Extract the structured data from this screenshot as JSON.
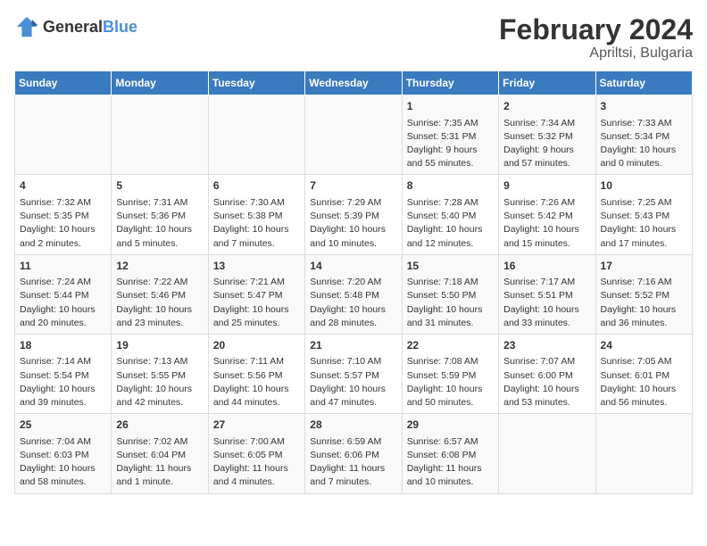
{
  "header": {
    "logo_general": "General",
    "logo_blue": "Blue",
    "title": "February 2024",
    "subtitle": "Apriltsi, Bulgaria"
  },
  "weekdays": [
    "Sunday",
    "Monday",
    "Tuesday",
    "Wednesday",
    "Thursday",
    "Friday",
    "Saturday"
  ],
  "weeks": [
    [
      {
        "day": "",
        "info": ""
      },
      {
        "day": "",
        "info": ""
      },
      {
        "day": "",
        "info": ""
      },
      {
        "day": "",
        "info": ""
      },
      {
        "day": "1",
        "info": "Sunrise: 7:35 AM\nSunset: 5:31 PM\nDaylight: 9 hours and 55 minutes."
      },
      {
        "day": "2",
        "info": "Sunrise: 7:34 AM\nSunset: 5:32 PM\nDaylight: 9 hours and 57 minutes."
      },
      {
        "day": "3",
        "info": "Sunrise: 7:33 AM\nSunset: 5:34 PM\nDaylight: 10 hours and 0 minutes."
      }
    ],
    [
      {
        "day": "4",
        "info": "Sunrise: 7:32 AM\nSunset: 5:35 PM\nDaylight: 10 hours and 2 minutes."
      },
      {
        "day": "5",
        "info": "Sunrise: 7:31 AM\nSunset: 5:36 PM\nDaylight: 10 hours and 5 minutes."
      },
      {
        "day": "6",
        "info": "Sunrise: 7:30 AM\nSunset: 5:38 PM\nDaylight: 10 hours and 7 minutes."
      },
      {
        "day": "7",
        "info": "Sunrise: 7:29 AM\nSunset: 5:39 PM\nDaylight: 10 hours and 10 minutes."
      },
      {
        "day": "8",
        "info": "Sunrise: 7:28 AM\nSunset: 5:40 PM\nDaylight: 10 hours and 12 minutes."
      },
      {
        "day": "9",
        "info": "Sunrise: 7:26 AM\nSunset: 5:42 PM\nDaylight: 10 hours and 15 minutes."
      },
      {
        "day": "10",
        "info": "Sunrise: 7:25 AM\nSunset: 5:43 PM\nDaylight: 10 hours and 17 minutes."
      }
    ],
    [
      {
        "day": "11",
        "info": "Sunrise: 7:24 AM\nSunset: 5:44 PM\nDaylight: 10 hours and 20 minutes."
      },
      {
        "day": "12",
        "info": "Sunrise: 7:22 AM\nSunset: 5:46 PM\nDaylight: 10 hours and 23 minutes."
      },
      {
        "day": "13",
        "info": "Sunrise: 7:21 AM\nSunset: 5:47 PM\nDaylight: 10 hours and 25 minutes."
      },
      {
        "day": "14",
        "info": "Sunrise: 7:20 AM\nSunset: 5:48 PM\nDaylight: 10 hours and 28 minutes."
      },
      {
        "day": "15",
        "info": "Sunrise: 7:18 AM\nSunset: 5:50 PM\nDaylight: 10 hours and 31 minutes."
      },
      {
        "day": "16",
        "info": "Sunrise: 7:17 AM\nSunset: 5:51 PM\nDaylight: 10 hours and 33 minutes."
      },
      {
        "day": "17",
        "info": "Sunrise: 7:16 AM\nSunset: 5:52 PM\nDaylight: 10 hours and 36 minutes."
      }
    ],
    [
      {
        "day": "18",
        "info": "Sunrise: 7:14 AM\nSunset: 5:54 PM\nDaylight: 10 hours and 39 minutes."
      },
      {
        "day": "19",
        "info": "Sunrise: 7:13 AM\nSunset: 5:55 PM\nDaylight: 10 hours and 42 minutes."
      },
      {
        "day": "20",
        "info": "Sunrise: 7:11 AM\nSunset: 5:56 PM\nDaylight: 10 hours and 44 minutes."
      },
      {
        "day": "21",
        "info": "Sunrise: 7:10 AM\nSunset: 5:57 PM\nDaylight: 10 hours and 47 minutes."
      },
      {
        "day": "22",
        "info": "Sunrise: 7:08 AM\nSunset: 5:59 PM\nDaylight: 10 hours and 50 minutes."
      },
      {
        "day": "23",
        "info": "Sunrise: 7:07 AM\nSunset: 6:00 PM\nDaylight: 10 hours and 53 minutes."
      },
      {
        "day": "24",
        "info": "Sunrise: 7:05 AM\nSunset: 6:01 PM\nDaylight: 10 hours and 56 minutes."
      }
    ],
    [
      {
        "day": "25",
        "info": "Sunrise: 7:04 AM\nSunset: 6:03 PM\nDaylight: 10 hours and 58 minutes."
      },
      {
        "day": "26",
        "info": "Sunrise: 7:02 AM\nSunset: 6:04 PM\nDaylight: 11 hours and 1 minute."
      },
      {
        "day": "27",
        "info": "Sunrise: 7:00 AM\nSunset: 6:05 PM\nDaylight: 11 hours and 4 minutes."
      },
      {
        "day": "28",
        "info": "Sunrise: 6:59 AM\nSunset: 6:06 PM\nDaylight: 11 hours and 7 minutes."
      },
      {
        "day": "29",
        "info": "Sunrise: 6:57 AM\nSunset: 6:08 PM\nDaylight: 11 hours and 10 minutes."
      },
      {
        "day": "",
        "info": ""
      },
      {
        "day": "",
        "info": ""
      }
    ]
  ]
}
